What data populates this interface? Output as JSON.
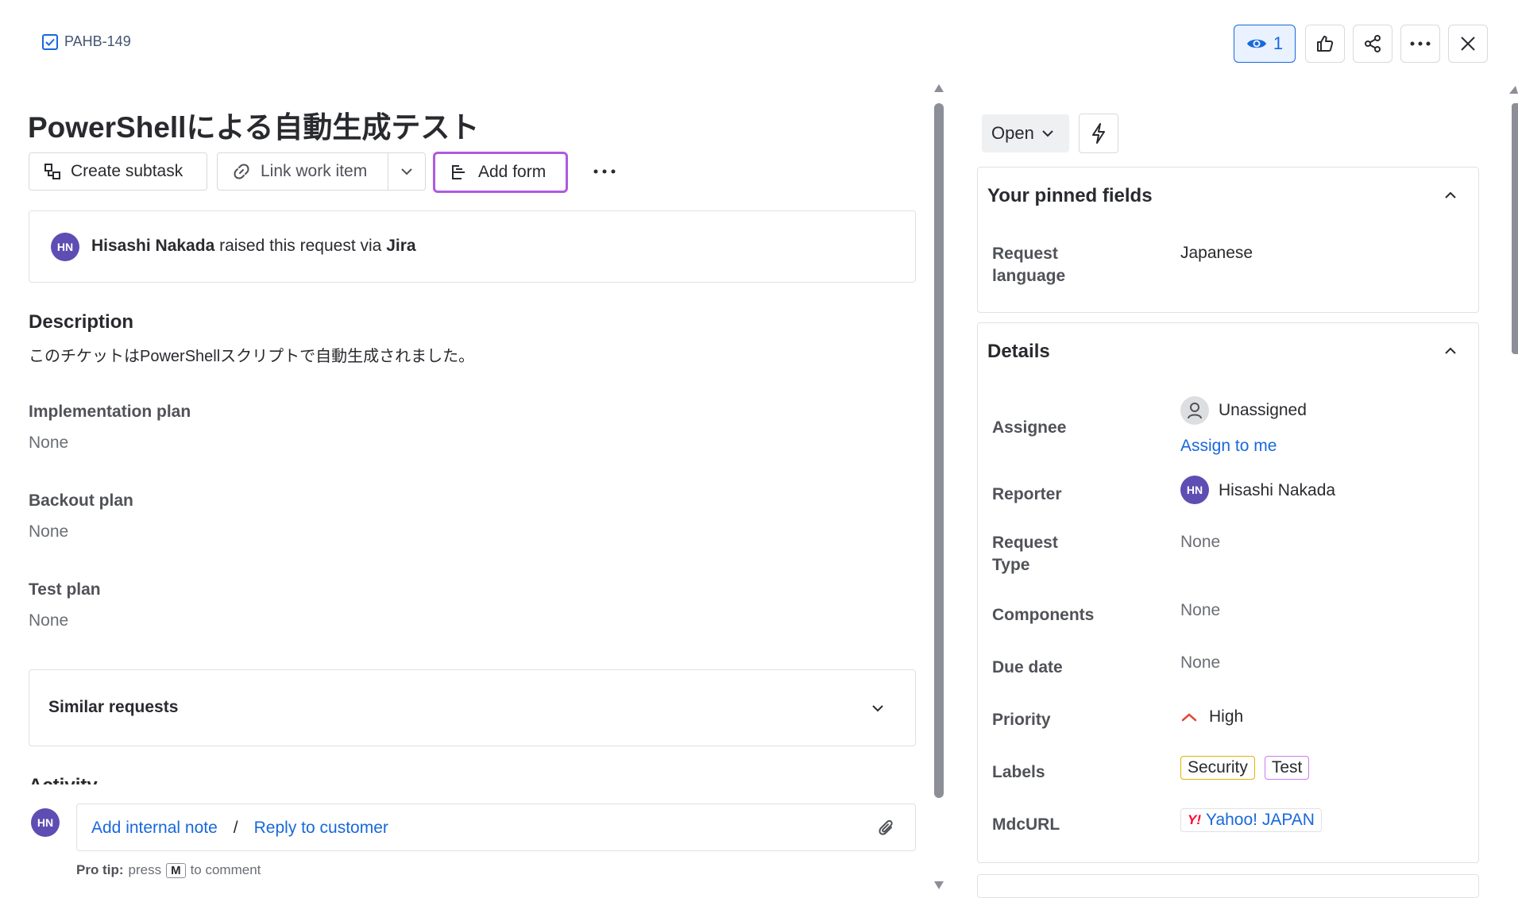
{
  "ticket": {
    "key": "PAHB-149"
  },
  "toolbar": {
    "watch_count": "1"
  },
  "title": "PowerShellによる自動生成テスト",
  "actions": {
    "create_subtask": "Create subtask",
    "link_work_item": "Link work item",
    "add_form": "Add form"
  },
  "raised": {
    "avatar": "HN",
    "user": "Hisashi Nakada",
    "middle": " raised this request via ",
    "channel": "Jira"
  },
  "description": {
    "heading": "Description",
    "text": "このチケットはPowerShellスクリプトで自動生成されました。"
  },
  "fields": [
    {
      "label": "Implementation plan",
      "value": "None"
    },
    {
      "label": "Backout plan",
      "value": "None"
    },
    {
      "label": "Test plan",
      "value": "None"
    }
  ],
  "similar": {
    "label": "Similar requests"
  },
  "activity": {
    "label": "Activity"
  },
  "comment": {
    "avatar": "HN",
    "internal_note": "Add internal note",
    "separator": "/",
    "reply": "Reply to customer",
    "tip_bold": "Pro tip:",
    "tip_press": "press",
    "tip_key": "M",
    "tip_rest": "to comment"
  },
  "status": {
    "label": "Open"
  },
  "pinned": {
    "heading": "Your pinned fields",
    "request_language_label_1": "Request",
    "request_language_label_2": "language",
    "request_language_value": "Japanese"
  },
  "details": {
    "heading": "Details",
    "assignee_label": "Assignee",
    "assignee_value": "Unassigned",
    "assign_to_me": "Assign to me",
    "reporter_label": "Reporter",
    "reporter_avatar": "HN",
    "reporter_value": "Hisashi Nakada",
    "request_type_label_1": "Request",
    "request_type_label_2": "Type",
    "request_type_value": "None",
    "components_label": "Components",
    "components_value": "None",
    "due_date_label": "Due date",
    "due_date_value": "None",
    "priority_label": "Priority",
    "priority_value": "High",
    "labels_label": "Labels",
    "labels": [
      "Security",
      "Test"
    ],
    "mdcurl_label": "MdcURL",
    "mdcurl_value": "Yahoo! JAPAN",
    "mdcurl_logo": "Y!"
  },
  "colors": {
    "accent": "#1868db",
    "avatar": "#5e4db2",
    "add_form_border": "#af59e1",
    "priority_high": "#e2483d",
    "label_security": "#e2b203",
    "label_test": "#c97cf4"
  }
}
